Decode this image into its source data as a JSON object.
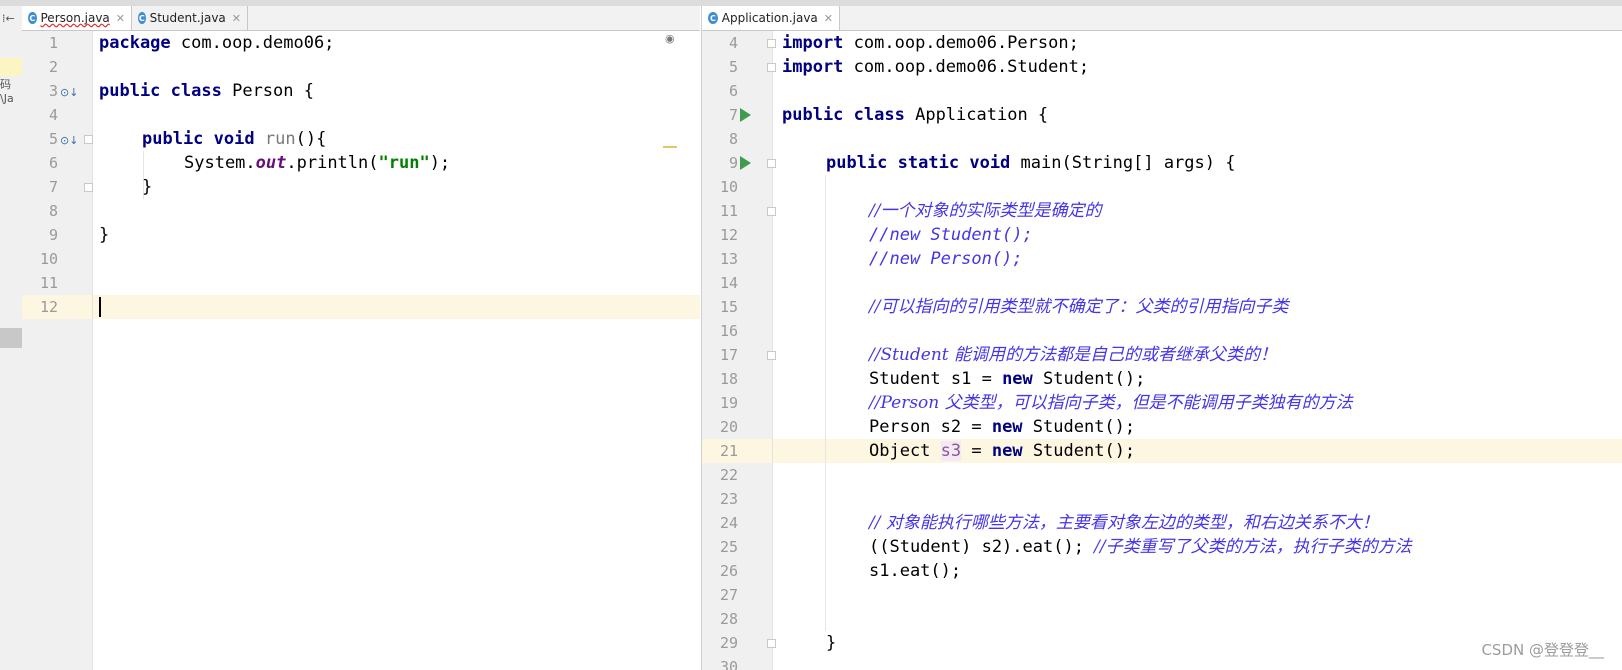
{
  "left_pane": {
    "tabs": [
      {
        "icon": "class-icon",
        "name": "Person.java",
        "active": true
      },
      {
        "icon": "class-icon",
        "name": "Student.java",
        "active": false
      }
    ],
    "line_numbers": [
      "1",
      "2",
      "3",
      "4",
      "5",
      "6",
      "7",
      "8",
      "9",
      "10",
      "11",
      "12"
    ],
    "current_line": "12",
    "code": {
      "l1_kw": "package",
      "l1_rest": " com.oop.demo06;",
      "l3_kw1": "public",
      "l3_kw2": "class",
      "l3_rest": " Person {",
      "l5_kw1": "public",
      "l5_kw2": "void",
      "l5_method": "run",
      "l5_rest": "(){",
      "l6_a": "System.",
      "l6_field": "out",
      "l6_b": ".println(",
      "l6_str": "\"run\"",
      "l6_c": ");",
      "l7": "}",
      "l9": "}"
    }
  },
  "right_pane": {
    "tabs": [
      {
        "icon": "class-icon",
        "name": "Application.java",
        "active": true
      }
    ],
    "line_numbers": [
      "4",
      "5",
      "6",
      "7",
      "8",
      "9",
      "10",
      "11",
      "12",
      "13",
      "14",
      "15",
      "16",
      "17",
      "18",
      "19",
      "20",
      "21",
      "22",
      "23",
      "24",
      "25",
      "26",
      "27",
      "28",
      "29",
      "30"
    ],
    "current_line": "21",
    "code": {
      "l4_kw": "import",
      "l4_rest": " com.oop.demo06.Person;",
      "l5_kw": "import",
      "l5_rest": " com.oop.demo06.Student;",
      "l7_kw1": "public",
      "l7_kw2": "class",
      "l7_rest": " Application {",
      "l9_kw1": "public",
      "l9_kw2": "static",
      "l9_kw3": "void",
      "l9_rest": " main(String[] args) {",
      "l11": "//一个对象的实际类型是确定的",
      "l12": "//new Student();",
      "l13": "//new Person();",
      "l15": "//可以指向的引用类型就不确定了：父类的引用指向子类",
      "l17": "//Student 能调用的方法都是自己的或者继承父类的！",
      "l18_a": "Student s1 = ",
      "l18_kw": "new",
      "l18_b": " Student();",
      "l19": "//Person 父类型，可以指向子类，但是不能调用子类独有的方法",
      "l20_a": "Person s2 = ",
      "l20_kw": "new",
      "l20_b": " Student();",
      "l21_a": "Object ",
      "l21_var": "s3",
      "l21_b": " = ",
      "l21_kw": "new",
      "l21_c": " Student();",
      "l24": "// 对象能执行哪些方法，主要看对象左边的类型，和右边关系不大！",
      "l25_a": "((Student) s2).eat(); ",
      "l25_cmt": "//子类重写了父类的方法，执行子类的方法",
      "l26": "s1.eat();",
      "l29": "}"
    }
  },
  "left_strip": {
    "glyph1": "⁞←",
    "glyph2": "码\\Ja"
  },
  "watermark": "CSDN @登登登__",
  "colors": {
    "keyword": "#000080",
    "string": "#008000",
    "comment": "#4535e6",
    "current_line": "#fdf6e0",
    "gutter": "#f0f0f0",
    "run_icon": "#3f9c4a"
  }
}
